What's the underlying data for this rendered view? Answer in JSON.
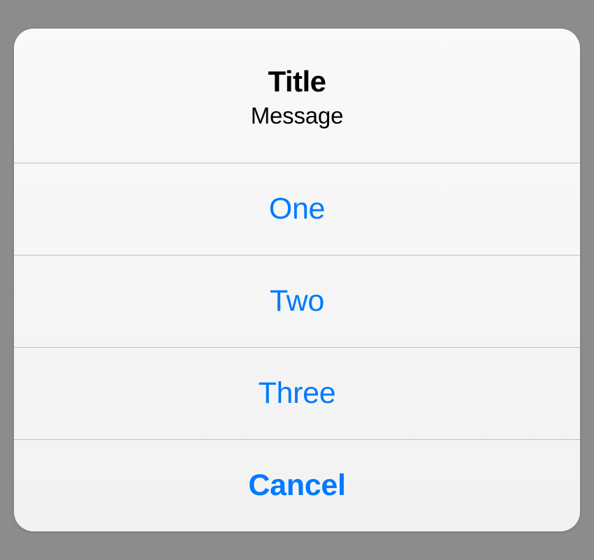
{
  "actionSheet": {
    "title": "Title",
    "message": "Message",
    "buttons": {
      "one": "One",
      "two": "Two",
      "three": "Three",
      "cancel": "Cancel"
    }
  }
}
